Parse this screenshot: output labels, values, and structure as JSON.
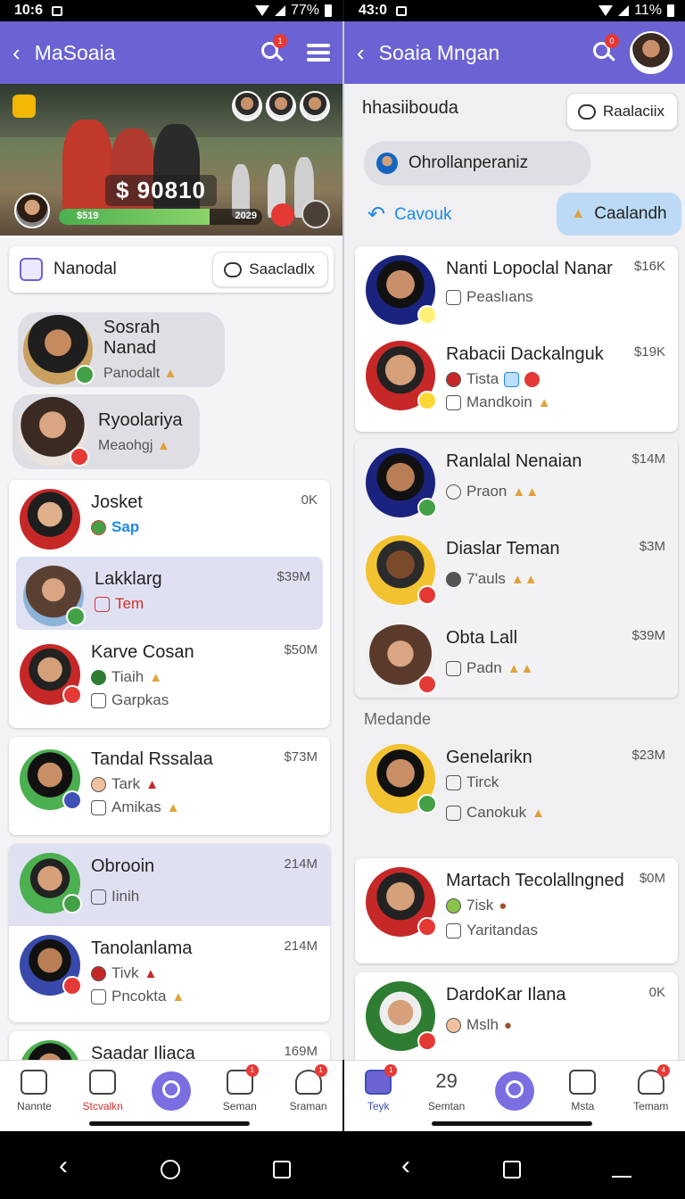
{
  "left": {
    "status": {
      "time": "10:6",
      "battery": "77%"
    },
    "appbar": {
      "title": "MaSoaia",
      "search_badge": "1"
    },
    "hero": {
      "amount": "$ 90810",
      "progress_left": "$519",
      "progress_right": "2029",
      "progress_fraction": 0.74
    },
    "search_label": "Nanodal",
    "search_chip": "Saacladlx",
    "bubbles": [
      {
        "name": "Sosrah Nanad",
        "sub": "Panodalt"
      },
      {
        "name": "Ryoolariya",
        "sub": "Meaohgj"
      }
    ],
    "card1": [
      {
        "name": "Josket",
        "amount": "0K",
        "line1": "Sap"
      },
      {
        "name": "Lakklarg",
        "amount": "$39M",
        "line1": "Tem"
      },
      {
        "name": "Karve Cosan",
        "amount": "$50M",
        "line1": "Tiaih",
        "line2": "Garpkas"
      }
    ],
    "card2": [
      {
        "name": "Tandal Rssalaa",
        "amount": "$73M",
        "line1": "Tark",
        "line2": "Amikas"
      }
    ],
    "card3": [
      {
        "name": "Obrooin",
        "amount": "214M",
        "line1": "Iinih"
      },
      {
        "name": "Tanolanlama",
        "amount": "214M",
        "line1": "Tivk",
        "line2": "Pncokta"
      }
    ],
    "card4": [
      {
        "name": "Saadar Iliaca",
        "amount": "169M"
      }
    ],
    "nav": [
      {
        "label": "Nannte"
      },
      {
        "label": "Stcvalkn"
      },
      {
        "label": ""
      },
      {
        "label": "Seman",
        "badge": "1"
      },
      {
        "label": "Sraman",
        "badge": "1"
      }
    ]
  },
  "right": {
    "status": {
      "time": "43:0",
      "battery": "11%"
    },
    "appbar": {
      "title": "Soaia Mngan",
      "search_badge": "0"
    },
    "header_title": "hhasiibouda",
    "header_chip": "Raalaciix",
    "pill": "Ohrollanperaniz",
    "link_left": "Cavouk",
    "bubble_right": "Caalandh",
    "card1": [
      {
        "name": "Nanti Lopoclal Nanar",
        "amount": "$16K",
        "line1": "Peaslıans"
      },
      {
        "name": "Rabacii Dackalnguk",
        "amount": "$19K",
        "line1": "Tista",
        "line2": "Mandkoin"
      }
    ],
    "card2": [
      {
        "name": "Ranlalal Nenaian",
        "amount": "$14M",
        "line1": "Praon"
      },
      {
        "name": "Diaslar Teman",
        "amount": "$3M",
        "line1": "7'auls"
      },
      {
        "name": "Obta Lall",
        "amount": "$39M",
        "line1": "Padn"
      }
    ],
    "section": "Medande",
    "gen": {
      "name": "Genelarikn",
      "amount": "$23M",
      "line1": "Tirck",
      "line2": "Canokuk"
    },
    "card3": [
      {
        "name": "Martach Tecolallngned",
        "amount": "$0M",
        "line1": "7isk",
        "line2": "Yaritandas"
      }
    ],
    "card4": [
      {
        "name": "DardoKar Ilana",
        "amount": "0K",
        "line1": "Mslh"
      }
    ],
    "nav": [
      {
        "label": "Teyk",
        "badge": "1"
      },
      {
        "label": "Semtan",
        "glyph": "29"
      },
      {
        "label": ""
      },
      {
        "label": "Msta"
      },
      {
        "label": "Temam",
        "badge": "4"
      }
    ]
  }
}
